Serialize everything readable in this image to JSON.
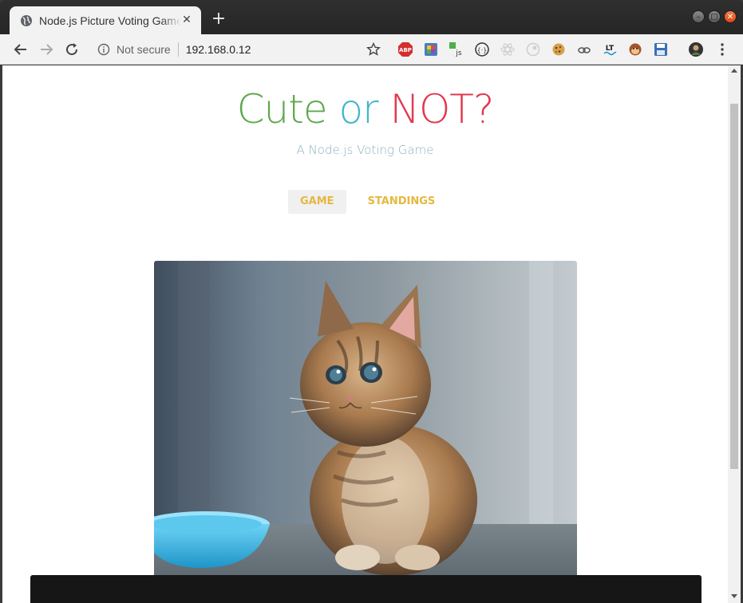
{
  "browser": {
    "tab_title": "Node.js Picture Voting Game",
    "tab_close": "✕",
    "new_tab": "+",
    "security_label": "Not secure",
    "url": "192.168.0.12"
  },
  "window_controls": {
    "minimize": "–",
    "maximize": "□",
    "close": "✕"
  },
  "extensions": [
    {
      "icon": "adblock-plus-icon",
      "color": "#d42e2e"
    },
    {
      "icon": "colorful-grid-icon",
      "color": "#4a7bc0"
    },
    {
      "icon": "js-extension-icon",
      "color": "#333333"
    },
    {
      "icon": "braces-circle-icon",
      "color": "#333333"
    },
    {
      "icon": "react-devtools-icon",
      "color": "#cfcfcf"
    },
    {
      "icon": "circle-dial-icon",
      "color": "#cfcfcf"
    },
    {
      "icon": "cookie-icon",
      "color": "#d7a04c"
    },
    {
      "icon": "link-chain-icon",
      "color": "#555555"
    },
    {
      "icon": "lt-wave-icon",
      "color": "#1a1a1a"
    },
    {
      "icon": "monkey-face-icon",
      "color": "#a3552b"
    },
    {
      "icon": "floppy-disk-icon",
      "color": "#3a6fb8"
    },
    {
      "icon": "user-avatar-icon",
      "color": "#333333"
    }
  ],
  "page": {
    "title_word1": "Cute",
    "title_word2": "or",
    "title_word3": "NOT?",
    "subtitle": "A Node.js Voting Game",
    "nav": [
      {
        "label": "GAME",
        "active": true
      },
      {
        "label": "STANDINGS",
        "active": false
      }
    ],
    "image_subject": "kitten-photo"
  },
  "colors": {
    "title_green": "#5fa84d",
    "title_blue": "#42b5cc",
    "title_red": "#e2384e",
    "subtitle": "#8fb2c0",
    "nav_accent": "#e5b83f"
  }
}
